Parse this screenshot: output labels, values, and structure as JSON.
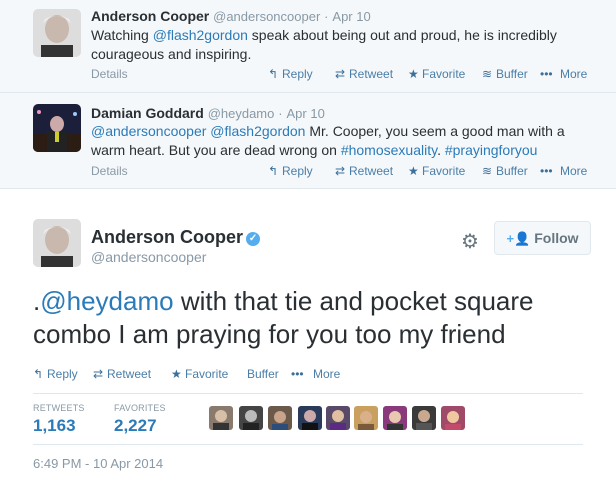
{
  "tweet1": {
    "name": "Anderson Cooper",
    "handle": "@andersoncooper",
    "time": "Apr 10",
    "text_before": "Watching ",
    "mention": "@flash2gordon",
    "text_after": " speak about being out and proud, he is incredibly courageous and inspiring.",
    "details": "Details",
    "actions": [
      "Reply",
      "Retweet",
      "Favorite",
      "Buffer",
      "More"
    ]
  },
  "tweet2": {
    "name": "Damian Goddard",
    "handle": "@heydamo",
    "time": "Apr 10",
    "mention1": "@andersoncooper",
    "mention2": "@flash2gordon",
    "text_mid": " Mr. Cooper, you seem a good man with a warm heart. But you are dead wrong on ",
    "hashtag1": "#homosexuality",
    "text_mid2": ". ",
    "hashtag2": "#prayingforyou",
    "details": "Details",
    "actions": [
      "Reply",
      "Retweet",
      "Favorite",
      "Buffer",
      "More"
    ]
  },
  "main": {
    "name": "Anderson Cooper",
    "handle": "@andersoncooper",
    "follow_label": "Follow",
    "text_prefix": ".",
    "mention": "@heydamo",
    "text": " with that tie and pocket square combo I am praying for you too my friend",
    "actions": [
      "Reply",
      "Retweet",
      "Favorite",
      "Buffer",
      "More"
    ],
    "retweets_label": "RETWEETS",
    "retweets": "1,163",
    "favorites_label": "FAVORITES",
    "favorites": "2,227",
    "timestamp": "6:49 PM - 10 Apr 2014"
  },
  "colors": {
    "link": "#2b7bb9",
    "verified": "#55acee",
    "muted": "#8899a6",
    "context_bg": "#f5f8fa"
  },
  "icons": [
    "reply-icon",
    "retweet-icon",
    "favorite-icon",
    "buffer-icon",
    "more-icon",
    "gear-icon",
    "follow-person-icon",
    "verified-icon"
  ]
}
